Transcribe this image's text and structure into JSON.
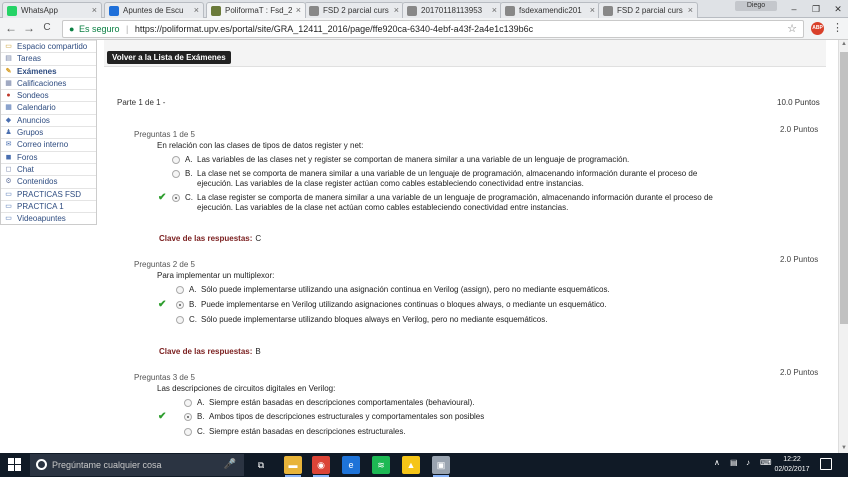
{
  "tabs": [
    {
      "label": "WhatsApp",
      "color": "#25d366"
    },
    {
      "label": "Apuntes de Escu",
      "color": "#1e6fd9"
    },
    {
      "label": "PoliformaT : Fsd_2",
      "color": "#6a7a3a"
    },
    {
      "label": "FSD 2 parcial curs",
      "color": "#888888"
    },
    {
      "label": "20170118113953",
      "color": "#888888"
    },
    {
      "label": "fsdexamendic201",
      "color": "#888888"
    },
    {
      "label": "FSD 2 parcial curs",
      "color": "#888888"
    }
  ],
  "window": {
    "user": "Diego",
    "minimize": "–",
    "maximize": "❐",
    "close": "✕"
  },
  "addressbar": {
    "back": "←",
    "forward": "→",
    "reload": "C",
    "secure_label": "Es seguro",
    "url": "https://poliformat.upv.es/portal/site/GRA_12411_2016/page/ffe920ca-6340-4ebf-a43f-2a4e1c139b6c",
    "star": "☆",
    "abp": "ABP",
    "menu": "⋮"
  },
  "sidebar": {
    "items": [
      {
        "label": "Espacio compartido",
        "icon": "folder-icon",
        "glyph": "▭",
        "color": "#c79b2c"
      },
      {
        "label": "Tareas",
        "icon": "tasks-icon",
        "glyph": "▤",
        "color": "#6b7aa1"
      },
      {
        "label": "Exámenes",
        "icon": "pencil-icon",
        "glyph": "✎",
        "color": "#d8a02a",
        "active": true
      },
      {
        "label": "Calificaciones",
        "icon": "grades-icon",
        "glyph": "▦",
        "color": "#6b7aa1"
      },
      {
        "label": "Sondeos",
        "icon": "poll-icon",
        "glyph": "●",
        "color": "#c0392b"
      },
      {
        "label": "Calendario",
        "icon": "calendar-icon",
        "glyph": "▦",
        "color": "#4a6fb0"
      },
      {
        "label": "Anuncios",
        "icon": "announcements-icon",
        "glyph": "◆",
        "color": "#4a6fb0"
      },
      {
        "label": "Grupos",
        "icon": "groups-icon",
        "glyph": "♟",
        "color": "#4a6fb0"
      },
      {
        "label": "Correo interno",
        "icon": "mail-icon",
        "glyph": "✉",
        "color": "#4a6fb0"
      },
      {
        "label": "Foros",
        "icon": "forums-icon",
        "glyph": "◼",
        "color": "#4a6fb0"
      },
      {
        "label": "Chat",
        "icon": "chat-icon",
        "glyph": "◻",
        "color": "#6b7aa1"
      },
      {
        "label": "Contenidos",
        "icon": "content-icon",
        "glyph": "⚙",
        "color": "#6b7aa1"
      },
      {
        "label": "PRACTICAS FSD",
        "icon": "web-content-icon",
        "glyph": "▭",
        "color": "#4a6fb0"
      },
      {
        "label": "PRACTICA 1",
        "icon": "web-content-icon",
        "glyph": "▭",
        "color": "#4a6fb0"
      },
      {
        "label": "Videoapuntes",
        "icon": "video-icon",
        "glyph": "▭",
        "color": "#4a6fb0"
      }
    ]
  },
  "main": {
    "back_button": "Volver a la Lista de Exámenes",
    "part_label": "Parte 1 de 1 -",
    "part_points": "10.0 Puntos",
    "answer_key_label": "Clave de las respuestas:",
    "questions": [
      {
        "header": "Preguntas 1 de 5",
        "points": "2.0 Puntos",
        "text": "En relación con las clases de tipos de datos register y net:",
        "options": [
          {
            "letter": "A.",
            "text": "Las variables de las clases net y register se comportan de manera similar a una variable de un lenguaje de programación."
          },
          {
            "letter": "B.",
            "text": "La clase net se comporta de manera similar a una variable de un lenguaje de programación, almacenando información durante el proceso de ejecución. Las variables de la clase register actúan como cables estableciendo conectividad entre instancias."
          },
          {
            "letter": "C.",
            "text": "La clase register se comporta de manera similar a una variable de un lenguaje de programación, almacenando información durante el proceso de ejecución. Las variables de la clase net actúan como cables estableciendo conectividad entre instancias.",
            "selected": true,
            "correct": true
          }
        ],
        "answer_key": "C"
      },
      {
        "header": "Preguntas 2 de 5",
        "points": "2.0 Puntos",
        "text": "Para implementar un multiplexor:",
        "options": [
          {
            "letter": "A.",
            "text": "Sólo puede implementarse utilizando una asignación continua en Verilog (assign), pero no mediante esquemáticos."
          },
          {
            "letter": "B.",
            "text": "Puede implementarse en Verilog utilizando asignaciones continuas o bloques always, o mediante un esquemático.",
            "selected": true,
            "correct": true
          },
          {
            "letter": "C.",
            "text": "Sólo puede implementarse utilizando bloques always en Verilog, pero no mediante esquemáticos."
          }
        ],
        "answer_key": "B"
      },
      {
        "header": "Preguntas 3 de 5",
        "points": "2.0 Puntos",
        "text": "Las descripciones de circuitos digitales en Verilog:",
        "options": [
          {
            "letter": "A.",
            "text": "Siempre están basadas en descripciones comportamentales (behavioural)."
          },
          {
            "letter": "B.",
            "text": "Ambos tipos de descripciones estructurales y comportamentales son posibles",
            "selected": true,
            "correct": true
          },
          {
            "letter": "C.",
            "text": "Siempre están basadas en descripciones estructurales."
          }
        ]
      }
    ]
  },
  "taskbar": {
    "search_placeholder": "Pregúntame cualquier cosa",
    "mic": "🎤",
    "apps": [
      {
        "name": "task-view",
        "color": "#101a26",
        "glyph": "⧉"
      },
      {
        "name": "file-explorer",
        "color": "#e8b43a",
        "glyph": "▬"
      },
      {
        "name": "chrome",
        "color": "#db4437",
        "glyph": "◉"
      },
      {
        "name": "edge",
        "color": "#1e73d8",
        "glyph": "e"
      },
      {
        "name": "spotify",
        "color": "#1db954",
        "glyph": "≋"
      },
      {
        "name": "norton",
        "color": "#f5c518",
        "glyph": "▲"
      },
      {
        "name": "app-window",
        "color": "#9aa4b0",
        "glyph": "▣"
      }
    ],
    "tray_up": "∧",
    "clock_time": "12:22",
    "clock_date": "02/02/2017"
  }
}
